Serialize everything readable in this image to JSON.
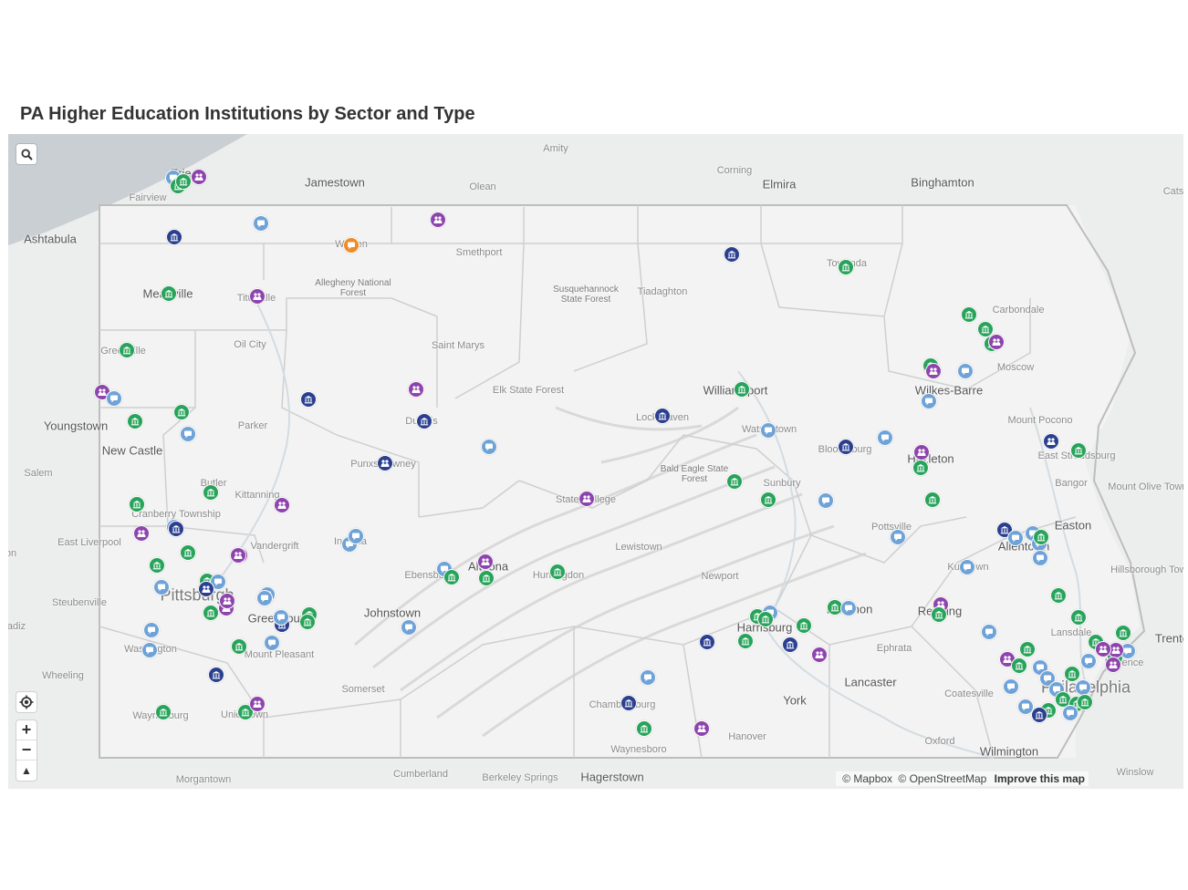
{
  "title": "PA Higher Education Institutions by Sector and Type",
  "colors": {
    "water": "#c9cfd3",
    "land": "#eceded",
    "pa_land": "#f3f3f3",
    "border": "#c8c8c8",
    "navy": "#2a3f8f",
    "purple": "#8e44ad",
    "green": "#27a35a",
    "lightblue": "#6fa3d8",
    "orange": "#f08a24"
  },
  "places": [
    {
      "name": "Jamestown",
      "kind": "city"
    },
    {
      "name": "Elmira",
      "kind": "city"
    },
    {
      "name": "Binghamton",
      "kind": "city"
    },
    {
      "name": "Ashtabula",
      "kind": "city"
    },
    {
      "name": "Erie",
      "kind": "city"
    },
    {
      "name": "Fairview",
      "kind": "town"
    },
    {
      "name": "Amity",
      "kind": "town"
    },
    {
      "name": "Corning",
      "kind": "town"
    },
    {
      "name": "Olean",
      "kind": "town"
    },
    {
      "name": "Cats",
      "kind": "town"
    },
    {
      "name": "Warren",
      "kind": "town"
    },
    {
      "name": "Smethport",
      "kind": "town"
    },
    {
      "name": "Meadville",
      "kind": "city"
    },
    {
      "name": "Titusville",
      "kind": "town"
    },
    {
      "name": "Towanda",
      "kind": "town"
    },
    {
      "name": "Tiadaghton",
      "kind": "town"
    },
    {
      "name": "Carbondale",
      "kind": "town"
    },
    {
      "name": "Greenville",
      "kind": "town"
    },
    {
      "name": "Oil City",
      "kind": "town"
    },
    {
      "name": "Saint Marys",
      "kind": "town"
    },
    {
      "name": "Moscow",
      "kind": "town"
    },
    {
      "name": "Williamsport",
      "kind": "city"
    },
    {
      "name": "Wilkes-Barre",
      "kind": "city"
    },
    {
      "name": "Elk State Forest",
      "kind": "town"
    },
    {
      "name": "Lock Haven",
      "kind": "town"
    },
    {
      "name": "Youngstown",
      "kind": "city"
    },
    {
      "name": "Parker",
      "kind": "town"
    },
    {
      "name": "DuBois",
      "kind": "town"
    },
    {
      "name": "Watsontown",
      "kind": "town"
    },
    {
      "name": "Mount Pocono",
      "kind": "town"
    },
    {
      "name": "New Castle",
      "kind": "city"
    },
    {
      "name": "Bloomsburg",
      "kind": "town"
    },
    {
      "name": "East Stroudsburg",
      "kind": "town"
    },
    {
      "name": "Hazleton",
      "kind": "city"
    },
    {
      "name": "Salem",
      "kind": "town"
    },
    {
      "name": "Punxsutawney",
      "kind": "town"
    },
    {
      "name": "Butler",
      "kind": "town"
    },
    {
      "name": "Sunbury",
      "kind": "town"
    },
    {
      "name": "Bangor",
      "kind": "town"
    },
    {
      "name": "Mount Olive Township",
      "kind": "town"
    },
    {
      "name": "Kittanning",
      "kind": "town"
    },
    {
      "name": "State College",
      "kind": "town"
    },
    {
      "name": "Cranberry Township",
      "kind": "town"
    },
    {
      "name": "Pottsville",
      "kind": "town"
    },
    {
      "name": "Easton",
      "kind": "city"
    },
    {
      "name": "East Liverpool",
      "kind": "town"
    },
    {
      "name": "Indiana",
      "kind": "town"
    },
    {
      "name": "Allentown",
      "kind": "city"
    },
    {
      "name": "Vandergrift",
      "kind": "town"
    },
    {
      "name": "Lewistown",
      "kind": "town"
    },
    {
      "name": "Hillsborough Township",
      "kind": "town"
    },
    {
      "name": "Altoona",
      "kind": "city"
    },
    {
      "name": "Ebensburg",
      "kind": "town"
    },
    {
      "name": "Huntingdon",
      "kind": "town"
    },
    {
      "name": "Kutztown",
      "kind": "town"
    },
    {
      "name": "Pittsburgh",
      "kind": "big"
    },
    {
      "name": "Newport",
      "kind": "town"
    },
    {
      "name": "Steubenville",
      "kind": "town"
    },
    {
      "name": "Lebanon",
      "kind": "city"
    },
    {
      "name": "Reading",
      "kind": "city"
    },
    {
      "name": "Johnstown",
      "kind": "city"
    },
    {
      "name": "Greensburg",
      "kind": "city"
    },
    {
      "name": "Harrisburg",
      "kind": "city"
    },
    {
      "name": "Lansdale",
      "kind": "town"
    },
    {
      "name": "Trenton",
      "kind": "city"
    },
    {
      "name": "Washington",
      "kind": "town"
    },
    {
      "name": "Ephrata",
      "kind": "town"
    },
    {
      "name": "Mount Pleasant",
      "kind": "town"
    },
    {
      "name": "Florence",
      "kind": "town"
    },
    {
      "name": "Wheeling",
      "kind": "town"
    },
    {
      "name": "Lancaster",
      "kind": "city"
    },
    {
      "name": "Philadelphia",
      "kind": "big"
    },
    {
      "name": "Somerset",
      "kind": "town"
    },
    {
      "name": "Coatesville",
      "kind": "town"
    },
    {
      "name": "York",
      "kind": "city"
    },
    {
      "name": "Chambersburg",
      "kind": "town"
    },
    {
      "name": "Waynesburg",
      "kind": "town"
    },
    {
      "name": "Uniontown",
      "kind": "town"
    },
    {
      "name": "Hanover",
      "kind": "town"
    },
    {
      "name": "Oxford",
      "kind": "town"
    },
    {
      "name": "Waynesboro",
      "kind": "town"
    },
    {
      "name": "Wilmington",
      "kind": "city"
    },
    {
      "name": "Morgantown",
      "kind": "town"
    },
    {
      "name": "Cumberland",
      "kind": "town"
    },
    {
      "name": "Berkeley Springs",
      "kind": "town"
    },
    {
      "name": "Hagerstown",
      "kind": "city"
    },
    {
      "name": "Winslow",
      "kind": "town"
    },
    {
      "name": "adiz",
      "kind": "town"
    },
    {
      "name": "on",
      "kind": "town"
    }
  ],
  "forests": [
    {
      "name": "Allegheny National Forest"
    },
    {
      "name": "Susquehannock State Forest"
    },
    {
      "name": "Bald Eagle State Forest"
    }
  ],
  "controls": {
    "search_icon": "search-icon",
    "locate_icon": "locate-icon",
    "zoom_in": "+",
    "zoom_out": "−",
    "compass": "▲"
  },
  "attribution": {
    "mapbox": "© Mapbox",
    "osm": "© OpenStreetMap",
    "improve": "Improve this map"
  },
  "markers": [
    {
      "c": "lightblue",
      "icon": "chat-icon"
    },
    {
      "c": "green",
      "icon": "bank-icon"
    },
    {
      "c": "green",
      "icon": "bank-icon"
    },
    {
      "c": "purple",
      "icon": "people-icon"
    },
    {
      "c": "navy",
      "icon": "bank-icon"
    },
    {
      "c": "lightblue",
      "icon": "chat-icon"
    },
    {
      "c": "purple",
      "icon": "people-icon"
    },
    {
      "c": "orange",
      "icon": "chat-icon"
    },
    {
      "c": "navy",
      "icon": "bank-icon"
    },
    {
      "c": "green",
      "icon": "bank-icon"
    },
    {
      "c": "purple",
      "icon": "people-icon"
    },
    {
      "c": "green",
      "icon": "bank-icon"
    },
    {
      "c": "green",
      "icon": "bank-icon"
    },
    {
      "c": "green",
      "icon": "bank-icon"
    },
    {
      "c": "green",
      "icon": "bank-icon"
    },
    {
      "c": "green",
      "icon": "bank-icon"
    },
    {
      "c": "purple",
      "icon": "people-icon"
    },
    {
      "c": "green",
      "icon": "bank-icon"
    },
    {
      "c": "purple",
      "icon": "people-icon"
    },
    {
      "c": "lightblue",
      "icon": "chat-icon"
    },
    {
      "c": "lightblue",
      "icon": "chat-icon"
    },
    {
      "c": "purple",
      "icon": "people-icon"
    },
    {
      "c": "lightblue",
      "icon": "chat-icon"
    },
    {
      "c": "green",
      "icon": "bank-icon"
    },
    {
      "c": "green",
      "icon": "bank-icon"
    },
    {
      "c": "navy",
      "icon": "bank-icon"
    },
    {
      "c": "lightblue",
      "icon": "chat-icon"
    },
    {
      "c": "purple",
      "icon": "people-icon"
    },
    {
      "c": "navy",
      "icon": "bank-icon"
    },
    {
      "c": "lightblue",
      "icon": "chat-icon"
    },
    {
      "c": "navy",
      "icon": "people-icon"
    },
    {
      "c": "green",
      "icon": "bank-icon"
    },
    {
      "c": "lightblue",
      "icon": "chat-icon"
    },
    {
      "c": "navy",
      "icon": "bank-icon"
    },
    {
      "c": "navy",
      "icon": "bank-icon"
    },
    {
      "c": "green",
      "icon": "bank-icon"
    },
    {
      "c": "purple",
      "icon": "people-icon"
    },
    {
      "c": "green",
      "icon": "bank-icon"
    },
    {
      "c": "lightblue",
      "icon": "chat-icon"
    },
    {
      "c": "green",
      "icon": "bank-icon"
    },
    {
      "c": "navy",
      "icon": "people-icon"
    },
    {
      "c": "green",
      "icon": "bank-icon"
    },
    {
      "c": "green",
      "icon": "bank-icon"
    },
    {
      "c": "lightblue",
      "icon": "chat-icon"
    },
    {
      "c": "green",
      "icon": "bank-icon"
    },
    {
      "c": "green",
      "icon": "bank-icon"
    },
    {
      "c": "lightblue",
      "icon": "chat-icon"
    },
    {
      "c": "purple",
      "icon": "people-icon"
    },
    {
      "c": "lightblue",
      "icon": "chat-icon"
    },
    {
      "c": "purple",
      "icon": "people-icon"
    },
    {
      "c": "purple",
      "icon": "people-icon"
    },
    {
      "c": "navy",
      "icon": "bank-icon"
    },
    {
      "c": "lightblue",
      "icon": "chat-icon"
    },
    {
      "c": "lightblue",
      "icon": "chat-icon"
    },
    {
      "c": "green",
      "icon": "bank-icon"
    },
    {
      "c": "green",
      "icon": "bank-icon"
    },
    {
      "c": "purple",
      "icon": "people-icon"
    },
    {
      "c": "lightblue",
      "icon": "chat-icon"
    },
    {
      "c": "green",
      "icon": "bank-icon"
    },
    {
      "c": "lightblue",
      "icon": "chat-icon"
    },
    {
      "c": "navy",
      "icon": "people-icon"
    },
    {
      "c": "lightblue",
      "icon": "chat-icon"
    },
    {
      "c": "green",
      "icon": "bank-icon"
    },
    {
      "c": "purple",
      "icon": "people-icon"
    },
    {
      "c": "lightblue",
      "icon": "chat-icon"
    },
    {
      "c": "purple",
      "icon": "people-icon"
    },
    {
      "c": "navy",
      "icon": "bank-icon"
    },
    {
      "c": "lightblue",
      "icon": "chat-icon"
    },
    {
      "c": "green",
      "icon": "bank-icon"
    },
    {
      "c": "green",
      "icon": "bank-icon"
    },
    {
      "c": "lightblue",
      "icon": "chat-icon"
    },
    {
      "c": "lightblue",
      "icon": "chat-icon"
    },
    {
      "c": "green",
      "icon": "bank-icon"
    },
    {
      "c": "lightblue",
      "icon": "chat-icon"
    },
    {
      "c": "navy",
      "icon": "bank-icon"
    },
    {
      "c": "green",
      "icon": "bank-icon"
    },
    {
      "c": "green",
      "icon": "bank-icon"
    },
    {
      "c": "purple",
      "icon": "people-icon"
    },
    {
      "c": "lightblue",
      "icon": "chat-icon"
    },
    {
      "c": "green",
      "icon": "bank-icon"
    },
    {
      "c": "lightblue",
      "icon": "chat-icon"
    },
    {
      "c": "green",
      "icon": "bank-icon"
    },
    {
      "c": "purple",
      "icon": "people-icon"
    },
    {
      "c": "green",
      "icon": "bank-icon"
    },
    {
      "c": "purple",
      "icon": "people-icon"
    },
    {
      "c": "green",
      "icon": "bank-icon"
    },
    {
      "c": "lightblue",
      "icon": "chat-icon"
    },
    {
      "c": "green",
      "icon": "bank-icon"
    },
    {
      "c": "green",
      "icon": "bank-icon"
    },
    {
      "c": "green",
      "icon": "bank-icon"
    },
    {
      "c": "navy",
      "icon": "bank-icon"
    },
    {
      "c": "purple",
      "icon": "people-icon"
    },
    {
      "c": "navy",
      "icon": "bank-icon"
    },
    {
      "c": "lightblue",
      "icon": "chat-icon"
    },
    {
      "c": "navy",
      "icon": "bank-icon"
    },
    {
      "c": "purple",
      "icon": "people-icon"
    },
    {
      "c": "green",
      "icon": "bank-icon"
    },
    {
      "c": "green",
      "icon": "bank-icon"
    },
    {
      "c": "lightblue",
      "icon": "chat-icon"
    },
    {
      "c": "purple",
      "icon": "people-icon"
    },
    {
      "c": "green",
      "icon": "bank-icon"
    },
    {
      "c": "lightblue",
      "icon": "chat-icon"
    },
    {
      "c": "navy",
      "icon": "bank-icon"
    },
    {
      "c": "lightblue",
      "icon": "chat-icon"
    },
    {
      "c": "lightblue",
      "icon": "chat-icon"
    },
    {
      "c": "lightblue",
      "icon": "chat-icon"
    },
    {
      "c": "lightblue",
      "icon": "chat-icon"
    },
    {
      "c": "green",
      "icon": "bank-icon"
    },
    {
      "c": "green",
      "icon": "bank-icon"
    },
    {
      "c": "green",
      "icon": "bank-icon"
    },
    {
      "c": "green",
      "icon": "bank-icon"
    },
    {
      "c": "green",
      "icon": "bank-icon"
    },
    {
      "c": "lightblue",
      "icon": "chat-icon"
    },
    {
      "c": "purple",
      "icon": "people-icon"
    },
    {
      "c": "green",
      "icon": "bank-icon"
    },
    {
      "c": "lightblue",
      "icon": "chat-icon"
    },
    {
      "c": "purple",
      "icon": "people-icon"
    },
    {
      "c": "green",
      "icon": "bank-icon"
    },
    {
      "c": "green",
      "icon": "bank-icon"
    },
    {
      "c": "lightblue",
      "icon": "chat-icon"
    },
    {
      "c": "lightblue",
      "icon": "chat-icon"
    },
    {
      "c": "lightblue",
      "icon": "chat-icon"
    },
    {
      "c": "green",
      "icon": "bank-icon"
    },
    {
      "c": "lightblue",
      "icon": "chat-icon"
    },
    {
      "c": "green",
      "icon": "bank-icon"
    },
    {
      "c": "green",
      "icon": "bank-icon"
    },
    {
      "c": "lightblue",
      "icon": "chat-icon"
    },
    {
      "c": "green",
      "icon": "bank-icon"
    },
    {
      "c": "lightblue",
      "icon": "chat-icon"
    },
    {
      "c": "purple",
      "icon": "people-icon"
    },
    {
      "c": "purple",
      "icon": "people-icon"
    },
    {
      "c": "lightblue",
      "icon": "chat-icon"
    },
    {
      "c": "lightblue",
      "icon": "chat-icon"
    },
    {
      "c": "green",
      "icon": "bank-icon"
    },
    {
      "c": "navy",
      "icon": "bank-icon"
    }
  ]
}
